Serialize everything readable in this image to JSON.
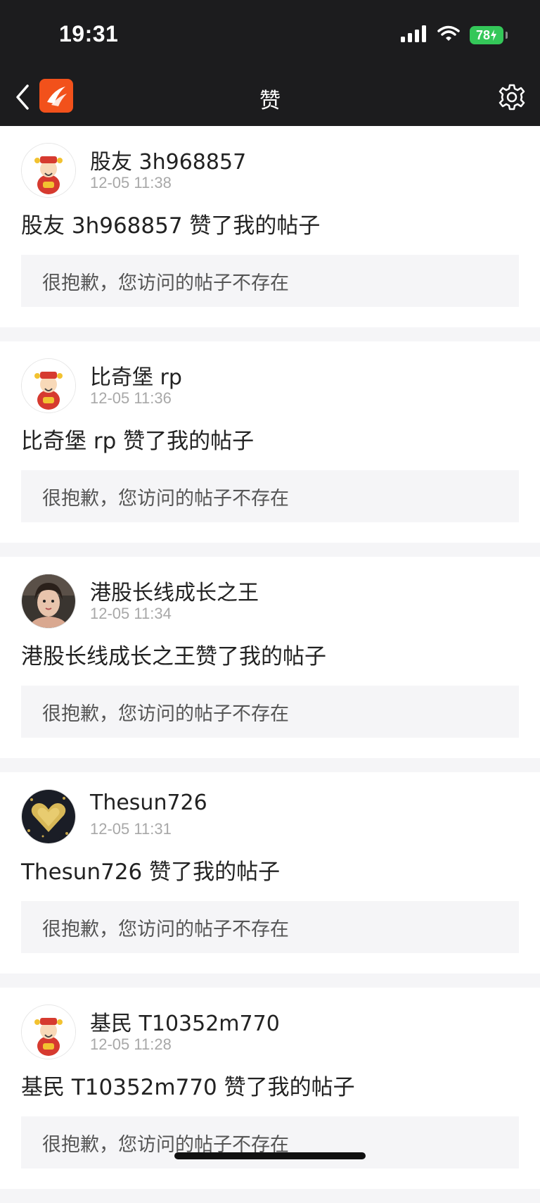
{
  "status_bar": {
    "time": "19:31",
    "battery": "78"
  },
  "nav": {
    "title": "赞",
    "back_icon": "chevron-left-icon",
    "settings_icon": "gear-icon"
  },
  "notifications": [
    {
      "avatar": "fortune-god-avatar",
      "user": "股友 3h968857",
      "time": "12-05 11:38",
      "message": "股友 3h968857 赞了我的帖子",
      "post_text": "很抱歉，您访问的帖子不存在"
    },
    {
      "avatar": "fortune-god-avatar",
      "user": "比奇堡 rp",
      "time": "12-05 11:36",
      "message": "比奇堡 rp 赞了我的帖子",
      "post_text": "很抱歉，您访问的帖子不存在"
    },
    {
      "avatar": "photo-avatar",
      "user": "港股长线成长之王",
      "time": "12-05 11:34",
      "message": "港股长线成长之王赞了我的帖子",
      "post_text": "很抱歉，您访问的帖子不存在"
    },
    {
      "avatar": "gold-heart-avatar",
      "user": "Thesun726",
      "time": "12-05 11:31",
      "message": "Thesun726 赞了我的帖子",
      "post_text": "很抱歉，您访问的帖子不存在"
    },
    {
      "avatar": "fortune-god-avatar",
      "user": "基民 T10352m770",
      "time": "12-05 11:28",
      "message": "基民 T10352m770 赞了我的帖子",
      "post_text": "很抱歉，您访问的帖子不存在"
    }
  ],
  "colors": {
    "brand": "#f2511b",
    "bar": "#1c1c1e",
    "battery": "#34c759"
  }
}
